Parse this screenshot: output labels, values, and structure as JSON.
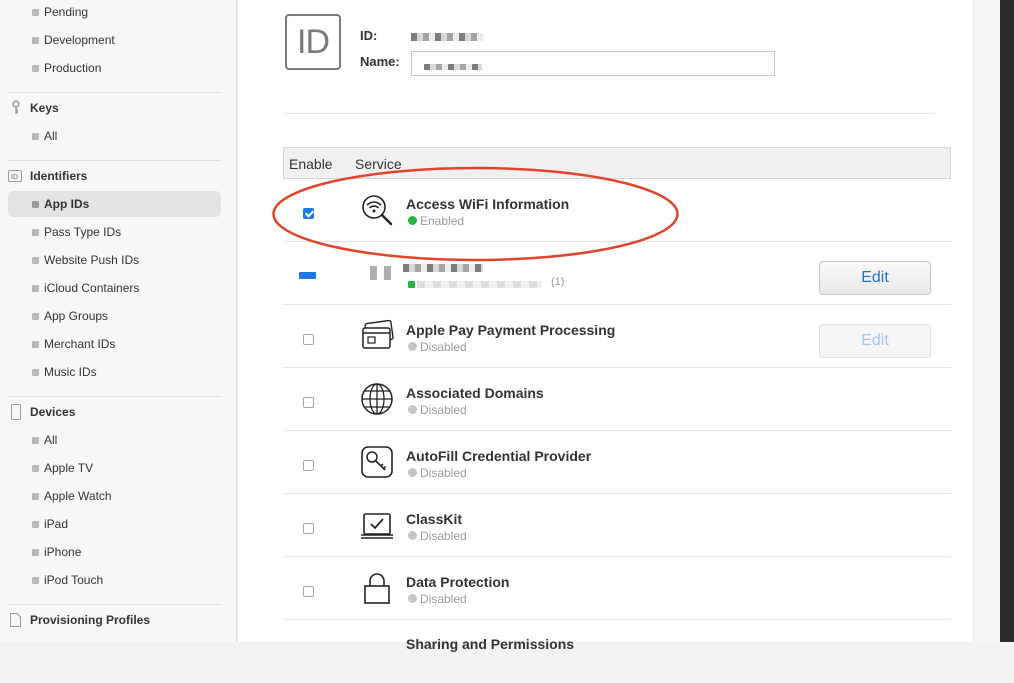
{
  "sidebar": {
    "top_items": [
      "Pending",
      "Development",
      "Production"
    ],
    "keys": {
      "title": "Keys",
      "items": [
        "All"
      ]
    },
    "identifiers": {
      "title": "Identifiers",
      "items": [
        "App IDs",
        "Pass Type IDs",
        "Website Push IDs",
        "iCloud Containers",
        "App Groups",
        "Merchant IDs",
        "Music IDs"
      ],
      "active": "App IDs"
    },
    "devices": {
      "title": "Devices",
      "items": [
        "All",
        "Apple TV",
        "Apple Watch",
        "iPad",
        "iPhone",
        "iPod Touch"
      ]
    },
    "profiles": {
      "title": "Provisioning Profiles"
    }
  },
  "appid": {
    "icon_text": "ID",
    "id_label": "ID:",
    "name_label": "Name:"
  },
  "table": {
    "col_enable": "Enable",
    "col_service": "Service",
    "rows": [
      {
        "name": "Access WiFi Information",
        "status": "Enabled",
        "checked": true,
        "icon": "wifi-search-icon"
      },
      {
        "name": "",
        "status": "",
        "count": "(1)",
        "edit": "Edit",
        "partial": true,
        "icon": "redacted-icon"
      },
      {
        "name": "Apple Pay Payment Processing",
        "status": "Disabled",
        "edit": "Edit",
        "icon": "payment-card-icon"
      },
      {
        "name": "Associated Domains",
        "status": "Disabled",
        "icon": "globe-icon"
      },
      {
        "name": "AutoFill Credential Provider",
        "status": "Disabled",
        "icon": "key-icon"
      },
      {
        "name": "ClassKit",
        "status": "Disabled",
        "icon": "classkit-icon"
      },
      {
        "name": "Data Protection",
        "status": "Disabled",
        "icon": "lock-icon"
      },
      {
        "name": "Sharing and Permissions",
        "status": "",
        "icon": "sharing-icon"
      }
    ]
  },
  "colors": {
    "accent": "#1e78e6",
    "enabled": "#27b543",
    "highlight": "#e0442b"
  }
}
